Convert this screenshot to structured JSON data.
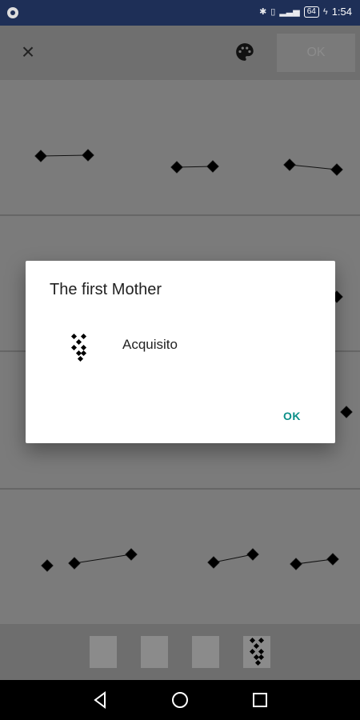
{
  "statusbar": {
    "time": "1:54",
    "battery": "64",
    "icons": [
      "app-circle-icon",
      "bluetooth-icon",
      "vibrate-icon",
      "signal-icon",
      "battery-icon"
    ]
  },
  "toolbar": {
    "ok_label": "OK",
    "icons": [
      "close-icon",
      "palette-icon"
    ]
  },
  "dialog": {
    "title": "The first Mother",
    "item_label": "Acquisito",
    "ok_label": "OK"
  },
  "colors": {
    "statusbar": "#1e2f57",
    "accent": "#0b8f88",
    "scrim": "#777777"
  },
  "bottom_thumbnails": [
    "empty",
    "empty",
    "empty",
    "geomantic-figure"
  ],
  "navigation": [
    "back-icon",
    "home-icon",
    "recents-icon"
  ]
}
